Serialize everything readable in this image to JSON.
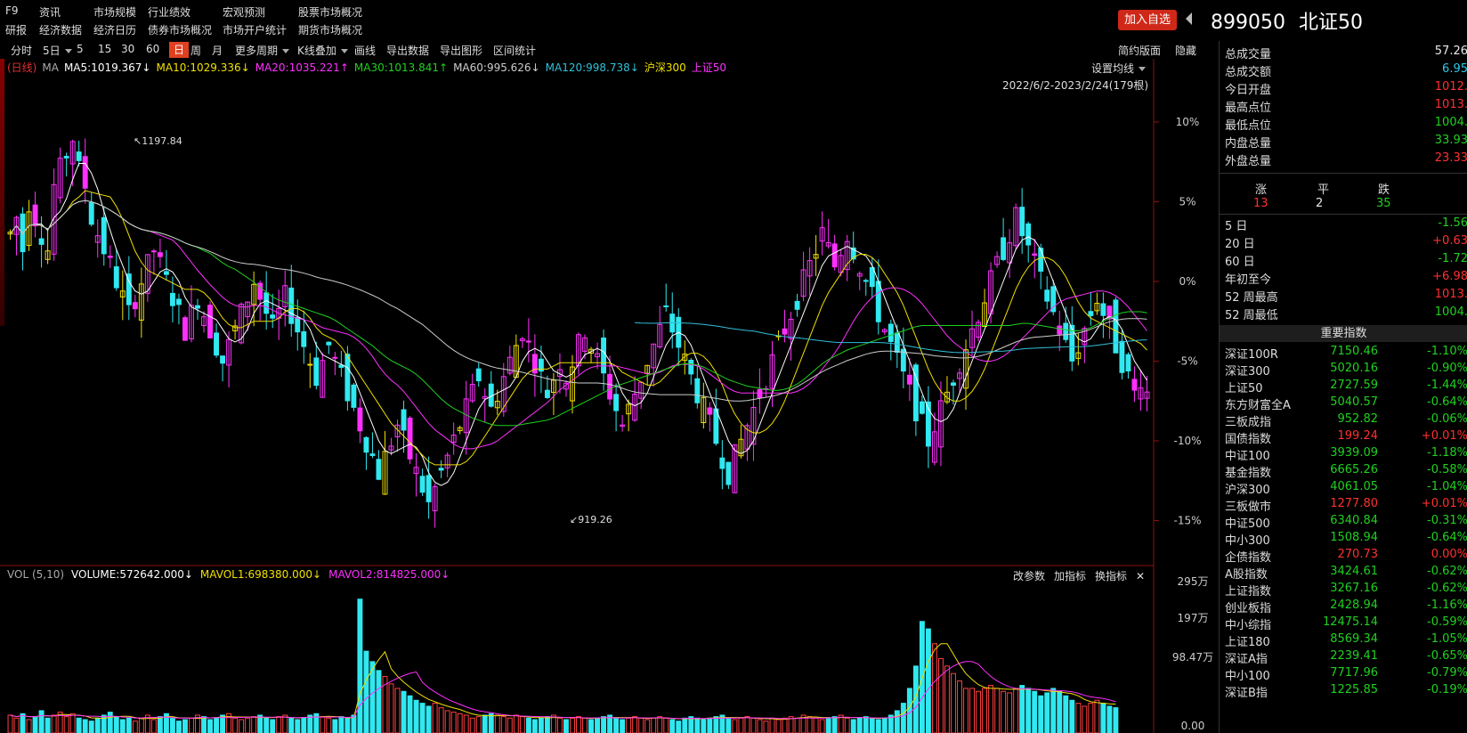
{
  "nav": {
    "row1": [
      "F9",
      "资讯",
      "市场规模",
      "行业绩效",
      "宏观预测",
      "股票市场概况"
    ],
    "row2": [
      "研报",
      "经济数据",
      "经济日历",
      "债券市场概况",
      "市场开户统计",
      "期货市场概况"
    ]
  },
  "header": {
    "add_button": "加入自选",
    "code": "899050",
    "name": "北证50"
  },
  "toolbar": {
    "items": [
      "分时",
      "5日",
      "5",
      "15",
      "30",
      "60",
      "日",
      "周",
      "月",
      "更多周期",
      "K线叠加",
      "画线",
      "导出数据",
      "导出图形",
      "区间统计"
    ],
    "active": "日",
    "right": [
      "简约版面",
      "隐藏"
    ]
  },
  "ma_legend": [
    {
      "text": "(日线)",
      "color": "#e03030"
    },
    {
      "text": "MA",
      "color": "#aaaaaa"
    },
    {
      "text": "MA5:1019.367↓",
      "color": "#ffffff"
    },
    {
      "text": "MA10:1029.336↓",
      "color": "#f0e000"
    },
    {
      "text": "MA20:1035.221↑",
      "color": "#ff30ff"
    },
    {
      "text": "MA30:1013.841↑",
      "color": "#20d020"
    },
    {
      "text": "MA60:995.626↓",
      "color": "#cccccc"
    },
    {
      "text": "MA120:998.738↓",
      "color": "#30c0d8"
    },
    {
      "text": "沪深300",
      "color": "#f0e000"
    },
    {
      "text": "上证50",
      "color": "#ff30ff"
    }
  ],
  "set_ma": "设置均线",
  "date_range": "2022/6/2-2023/2/24(179根)",
  "vol_legend": [
    {
      "text": "VOL (5,10)",
      "color": "#aaaaaa"
    },
    {
      "text": "VOLUME:572642.000↓",
      "color": "#ffffff"
    },
    {
      "text": "MAVOL1:698380.000↓",
      "color": "#f0e000"
    },
    {
      "text": "MAVOL2:814825.000↓",
      "color": "#ff30ff"
    }
  ],
  "vol_tools": [
    "改参数",
    "加指标",
    "换指标"
  ],
  "chart_data": {
    "type": "candlestick",
    "y_axis_pct_labels": [
      "10%",
      "5%",
      "0%",
      "-5%",
      "-10%",
      "-15%"
    ],
    "annotations": [
      {
        "text": "1197.84",
        "kind": "high"
      },
      {
        "text": "919.26",
        "kind": "low"
      }
    ],
    "vol_axis_labels": [
      "295万",
      "197万",
      "98.47万",
      "0.00"
    ],
    "close_series_pct": [
      3,
      4,
      2,
      5,
      4,
      3,
      2,
      6,
      7,
      8,
      9,
      7,
      6,
      4,
      3,
      2,
      1,
      0,
      -1,
      -2,
      -1,
      0,
      1,
      2,
      1,
      0,
      -1,
      -2,
      -3,
      -2,
      -1,
      -2,
      -3,
      -4,
      -5,
      -4,
      -3,
      -2,
      -1,
      0,
      -1,
      -2,
      -3,
      -2,
      -1,
      -2,
      -3,
      -4,
      -5,
      -6,
      -5,
      -4,
      -5,
      -6,
      -7,
      -8,
      -9,
      -10,
      -11,
      -12,
      -11,
      -10,
      -9,
      -10,
      -11,
      -12,
      -13,
      -14,
      -13,
      -12,
      -11,
      -10,
      -9,
      -8,
      -7,
      -6,
      -7,
      -8,
      -7,
      -6,
      -5,
      -4,
      -3,
      -4,
      -5,
      -6,
      -7,
      -6,
      -5,
      -6,
      -5,
      -4,
      -3,
      -4,
      -5,
      -6,
      -7,
      -8,
      -9,
      -8,
      -7,
      -6,
      -5,
      -4,
      -3,
      -2,
      -3,
      -4,
      -5,
      -6,
      -7,
      -8,
      -9,
      -10,
      -11,
      -12,
      -11,
      -10,
      -9,
      -8,
      -7,
      -6,
      -5,
      -4,
      -3,
      -2,
      -1,
      0,
      1,
      2,
      3,
      2,
      1,
      2,
      3,
      2,
      1,
      0,
      -1,
      -2,
      -3,
      -4,
      -5,
      -6,
      -7,
      -8,
      -9,
      -10,
      -9,
      -8,
      -7,
      -6,
      -5,
      -4,
      -3,
      -2,
      -1,
      0,
      1,
      2,
      3,
      4,
      3,
      2,
      1,
      0,
      -1,
      -2,
      -3,
      -4,
      -5,
      -4,
      -3,
      -2,
      -1,
      -2,
      -3,
      -4,
      -5,
      -6,
      -7,
      -6,
      -7
    ],
    "volume_rel": [
      0.12,
      0.1,
      0.13,
      0.09,
      0.11,
      0.15,
      0.1,
      0.12,
      0.14,
      0.11,
      0.13,
      0.1,
      0.09,
      0.08,
      0.1,
      0.12,
      0.14,
      0.11,
      0.09,
      0.1,
      0.08,
      0.1,
      0.12,
      0.09,
      0.11,
      0.13,
      0.1,
      0.08,
      0.09,
      0.1,
      0.12,
      0.11,
      0.09,
      0.1,
      0.12,
      0.13,
      0.1,
      0.09,
      0.1,
      0.11,
      0.12,
      0.1,
      0.09,
      0.11,
      0.12,
      0.1,
      0.09,
      0.1,
      0.12,
      0.13,
      0.11,
      0.1,
      0.09,
      0.11,
      0.1,
      0.12,
      0.9,
      0.55,
      0.48,
      0.42,
      0.38,
      0.33,
      0.3,
      0.28,
      0.25,
      0.22,
      0.2,
      0.18,
      0.2,
      0.17,
      0.15,
      0.14,
      0.13,
      0.12,
      0.1,
      0.11,
      0.12,
      0.13,
      0.12,
      0.11,
      0.1,
      0.12,
      0.11,
      0.1,
      0.09,
      0.1,
      0.11,
      0.12,
      0.1,
      0.09,
      0.1,
      0.11,
      0.1,
      0.09,
      0.1,
      0.11,
      0.12,
      0.1,
      0.09,
      0.1,
      0.11,
      0.1,
      0.09,
      0.1,
      0.11,
      0.1,
      0.09,
      0.08,
      0.1,
      0.11,
      0.1,
      0.09,
      0.1,
      0.11,
      0.12,
      0.1,
      0.09,
      0.1,
      0.11,
      0.1,
      0.09,
      0.08,
      0.1,
      0.09,
      0.1,
      0.11,
      0.1,
      0.12,
      0.11,
      0.1,
      0.09,
      0.1,
      0.11,
      0.12,
      0.1,
      0.09,
      0.1,
      0.11,
      0.1,
      0.09,
      0.1,
      0.12,
      0.15,
      0.2,
      0.3,
      0.45,
      0.75,
      0.7,
      0.6,
      0.5,
      0.45,
      0.4,
      0.35,
      0.3,
      0.3,
      0.28,
      0.3,
      0.32,
      0.3,
      0.28,
      0.27,
      0.3,
      0.32,
      0.3,
      0.28,
      0.25,
      0.27,
      0.3,
      0.28,
      0.25,
      0.22,
      0.2,
      0.18,
      0.2,
      0.22,
      0.2,
      0.18,
      0.17
    ]
  },
  "stats": [
    {
      "label": "总成交量",
      "value": "57.26",
      "color": "#e8e8e8"
    },
    {
      "label": "总成交额",
      "value": "6.95",
      "color": "#30c8e8"
    },
    {
      "label": "今日开盘",
      "value": "1012.",
      "color": "#ff3030"
    },
    {
      "label": "最高点位",
      "value": "1013.",
      "color": "#ff3030"
    },
    {
      "label": "最低点位",
      "value": "1004.",
      "color": "#20d020"
    },
    {
      "label": "内盘总量",
      "value": "33.93",
      "color": "#20d020"
    },
    {
      "label": "外盘总量",
      "value": "23.33",
      "color": "#ff3030"
    }
  ],
  "breadth": {
    "labels": [
      "涨",
      "平",
      "跌"
    ],
    "values": [
      "13",
      "2",
      "35"
    ],
    "colors": [
      "#ff3030",
      "#e8e8e8",
      "#20d020"
    ]
  },
  "periods": [
    {
      "label": "5 日",
      "value": "-1.56",
      "color": "#20d020"
    },
    {
      "label": "20 日",
      "value": "+0.63",
      "color": "#ff3030"
    },
    {
      "label": "60 日",
      "value": "-1.72",
      "color": "#20d020"
    },
    {
      "label": "年初至今",
      "value": "+6.98",
      "color": "#ff3030"
    },
    {
      "label": "52 周最高",
      "value": "1013.",
      "color": "#ff3030"
    },
    {
      "label": "52 周最低",
      "value": "1004.",
      "color": "#20d020"
    }
  ],
  "index_header": "重要指数",
  "indices": [
    {
      "name": "深证100R",
      "price": "7150.46",
      "change": "-1.10%",
      "up": false
    },
    {
      "name": "深证300",
      "price": "5020.16",
      "change": "-0.90%",
      "up": false
    },
    {
      "name": "上证50",
      "price": "2727.59",
      "change": "-1.44%",
      "up": false
    },
    {
      "name": "东方财富全A",
      "price": "5040.57",
      "change": "-0.64%",
      "up": false
    },
    {
      "name": "三板成指",
      "price": "952.82",
      "change": "-0.06%",
      "up": false
    },
    {
      "name": "国债指数",
      "price": "199.24",
      "change": "+0.01%",
      "up": true
    },
    {
      "name": "中证100",
      "price": "3939.09",
      "change": "-1.18%",
      "up": false
    },
    {
      "name": "基金指数",
      "price": "6665.26",
      "change": "-0.58%",
      "up": false
    },
    {
      "name": "沪深300",
      "price": "4061.05",
      "change": "-1.04%",
      "up": false
    },
    {
      "name": "三板做市",
      "price": "1277.80",
      "change": "+0.01%",
      "up": true
    },
    {
      "name": "中证500",
      "price": "6340.84",
      "change": "-0.31%",
      "up": false
    },
    {
      "name": "中小300",
      "price": "1508.94",
      "change": "-0.64%",
      "up": false
    },
    {
      "name": "企债指数",
      "price": "270.73",
      "change": "0.00%",
      "up": null
    },
    {
      "name": "A股指数",
      "price": "3424.61",
      "change": "-0.62%",
      "up": false
    },
    {
      "name": "上证指数",
      "price": "3267.16",
      "change": "-0.62%",
      "up": false
    },
    {
      "name": "创业板指",
      "price": "2428.94",
      "change": "-1.16%",
      "up": false
    },
    {
      "name": "中小综指",
      "price": "12475.14",
      "change": "-0.59%",
      "up": false
    },
    {
      "name": "上证180",
      "price": "8569.34",
      "change": "-1.05%",
      "up": false
    },
    {
      "name": "深证A指",
      "price": "2239.41",
      "change": "-0.65%",
      "up": false
    },
    {
      "name": "中小100",
      "price": "7717.96",
      "change": "-0.79%",
      "up": false
    },
    {
      "name": "深证B指",
      "price": "1225.85",
      "change": "-0.19%",
      "up": false
    }
  ]
}
